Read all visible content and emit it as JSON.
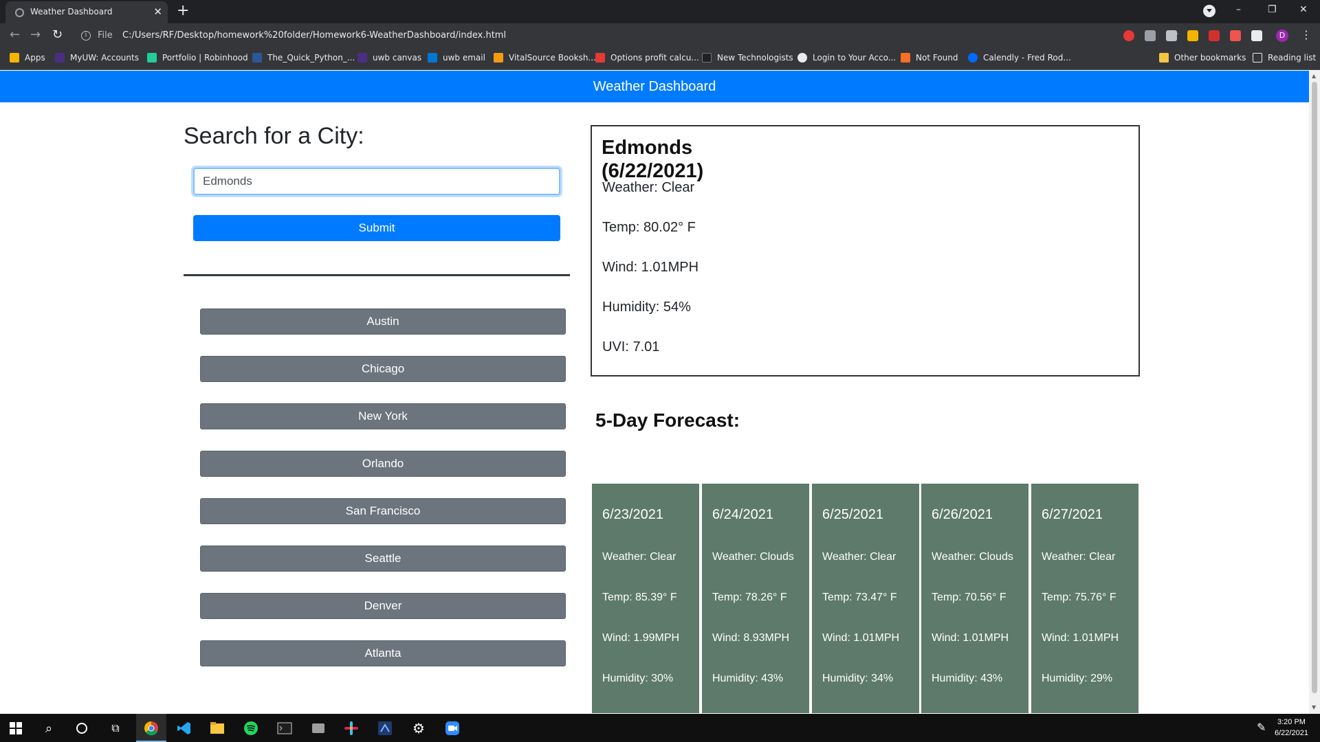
{
  "browser": {
    "tab_title": "Weather Dashboard",
    "tab_close": "✕",
    "new_tab": "+",
    "url_scheme": "File",
    "url": "C:/Users/RF/Desktop/homework%20folder/Homework6-WeatherDashboard/index.html",
    "window_controls": [
      "–",
      "❐",
      "✕"
    ],
    "avatar_letter": "D",
    "bookmarks": [
      {
        "label": "Apps",
        "color": "#f4b400"
      },
      {
        "label": "MyUW: Accounts",
        "color": "#4b2e83"
      },
      {
        "label": "Portfolio | Robinhood",
        "color": "#21ce99"
      },
      {
        "label": "The_Quick_Python_...",
        "color": "#2b579a"
      },
      {
        "label": "uwb canvas",
        "color": "#4b2e83"
      },
      {
        "label": "uwb email",
        "color": "#0078d4"
      },
      {
        "label": "VitalSource Booksh...",
        "color": "#f39c12"
      },
      {
        "label": "Options profit calcu...",
        "color": "#e53935"
      },
      {
        "label": "New Technologists",
        "color": "#202124"
      },
      {
        "label": "Login to Your Acco...",
        "color": "#e8eaed"
      },
      {
        "label": "Not Found",
        "color": "#fc6d26"
      },
      {
        "label": "Calendly - Fred Rod...",
        "color": "#006bff"
      }
    ],
    "other_bookmarks": "Other bookmarks",
    "reading_list": "Reading list"
  },
  "header": {
    "title": "Weather Dashboard"
  },
  "search": {
    "title": "Search for a City:",
    "input_value": "Edmonds",
    "submit_label": "Submit"
  },
  "history": [
    "Austin",
    "Chicago",
    "New York",
    "Orlando",
    "San Francisco",
    "Seattle",
    "Denver",
    "Atlanta"
  ],
  "current": {
    "city": "Edmonds",
    "date": "(6/22/2021)",
    "weather": "Weather: Clear",
    "temp": "Temp: 80.02° F",
    "wind": "Wind: 1.01MPH",
    "humidity": "Humidity: 54%",
    "uvi": "UVI: 7.01"
  },
  "forecast": {
    "title": "5-Day Forecast:",
    "days": [
      {
        "date": "6/23/2021",
        "weather": "Weather: Clear",
        "temp": "Temp: 85.39° F",
        "wind": "Wind: 1.99MPH",
        "humidity": "Humidity: 30%"
      },
      {
        "date": "6/24/2021",
        "weather": "Weather: Clouds",
        "temp": "Temp: 78.26° F",
        "wind": "Wind: 8.93MPH",
        "humidity": "Humidity: 43%"
      },
      {
        "date": "6/25/2021",
        "weather": "Weather: Clear",
        "temp": "Temp: 73.47° F",
        "wind": "Wind: 1.01MPH",
        "humidity": "Humidity: 34%"
      },
      {
        "date": "6/26/2021",
        "weather": "Weather: Clouds",
        "temp": "Temp: 70.56° F",
        "wind": "Wind: 1.01MPH",
        "humidity": "Humidity: 43%"
      },
      {
        "date": "6/27/2021",
        "weather": "Weather: Clear",
        "temp": "Temp: 75.76° F",
        "wind": "Wind: 1.01MPH",
        "humidity": "Humidity: 29%"
      }
    ]
  },
  "colors": {
    "accent": "#007bff",
    "history_button": "#6c757d",
    "forecast_card": "#5d7a6a"
  },
  "taskbar": {
    "time": "3:20 PM",
    "date": "6/22/2021",
    "icons": [
      "windows-start-icon",
      "search-icon",
      "cortana-icon",
      "task-view-icon",
      "chrome-icon",
      "vscode-icon",
      "file-explorer-icon",
      "spotify-icon",
      "terminal-icon",
      "app-icon",
      "slack-icon",
      "app-icon-2",
      "settings-icon",
      "zoom-icon"
    ]
  }
}
